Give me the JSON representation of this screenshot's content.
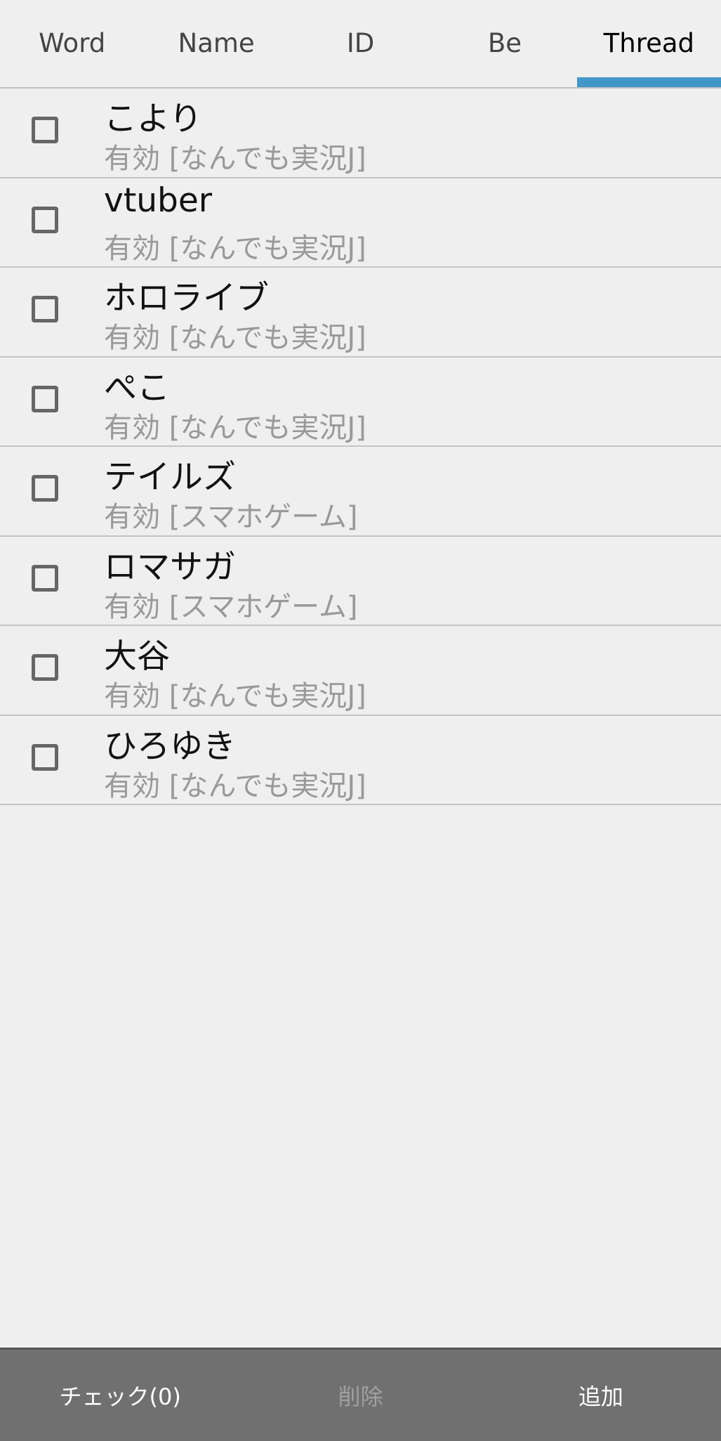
{
  "tabs": [
    {
      "label": "Word",
      "active": false
    },
    {
      "label": "Name",
      "active": false
    },
    {
      "label": "ID",
      "active": false
    },
    {
      "label": "Be",
      "active": false
    },
    {
      "label": "Thread",
      "active": true
    }
  ],
  "colors": {
    "accent": "#4397c8",
    "background": "#efefef",
    "bottom_bar": "#707070"
  },
  "items": [
    {
      "title": "こより",
      "subtitle": "有効 [なんでも実況J]",
      "checked": false
    },
    {
      "title": "vtuber",
      "subtitle": "有効 [なんでも実況J]",
      "checked": false
    },
    {
      "title": "ホロライブ",
      "subtitle": "有効 [なんでも実況J]",
      "checked": false
    },
    {
      "title": "ぺこ",
      "subtitle": "有効 [なんでも実況J]",
      "checked": false
    },
    {
      "title": "テイルズ",
      "subtitle": "有効 [スマホゲーム]",
      "checked": false
    },
    {
      "title": "ロマサガ",
      "subtitle": "有効 [スマホゲーム]",
      "checked": false
    },
    {
      "title": "大谷",
      "subtitle": "有効 [なんでも実況J]",
      "checked": false
    },
    {
      "title": "ひろゆき",
      "subtitle": "有効 [なんでも実況J]",
      "checked": false
    }
  ],
  "bottom_bar": {
    "check_label": "チェック(0)",
    "delete_label": "削除",
    "delete_enabled": false,
    "add_label": "追加"
  }
}
